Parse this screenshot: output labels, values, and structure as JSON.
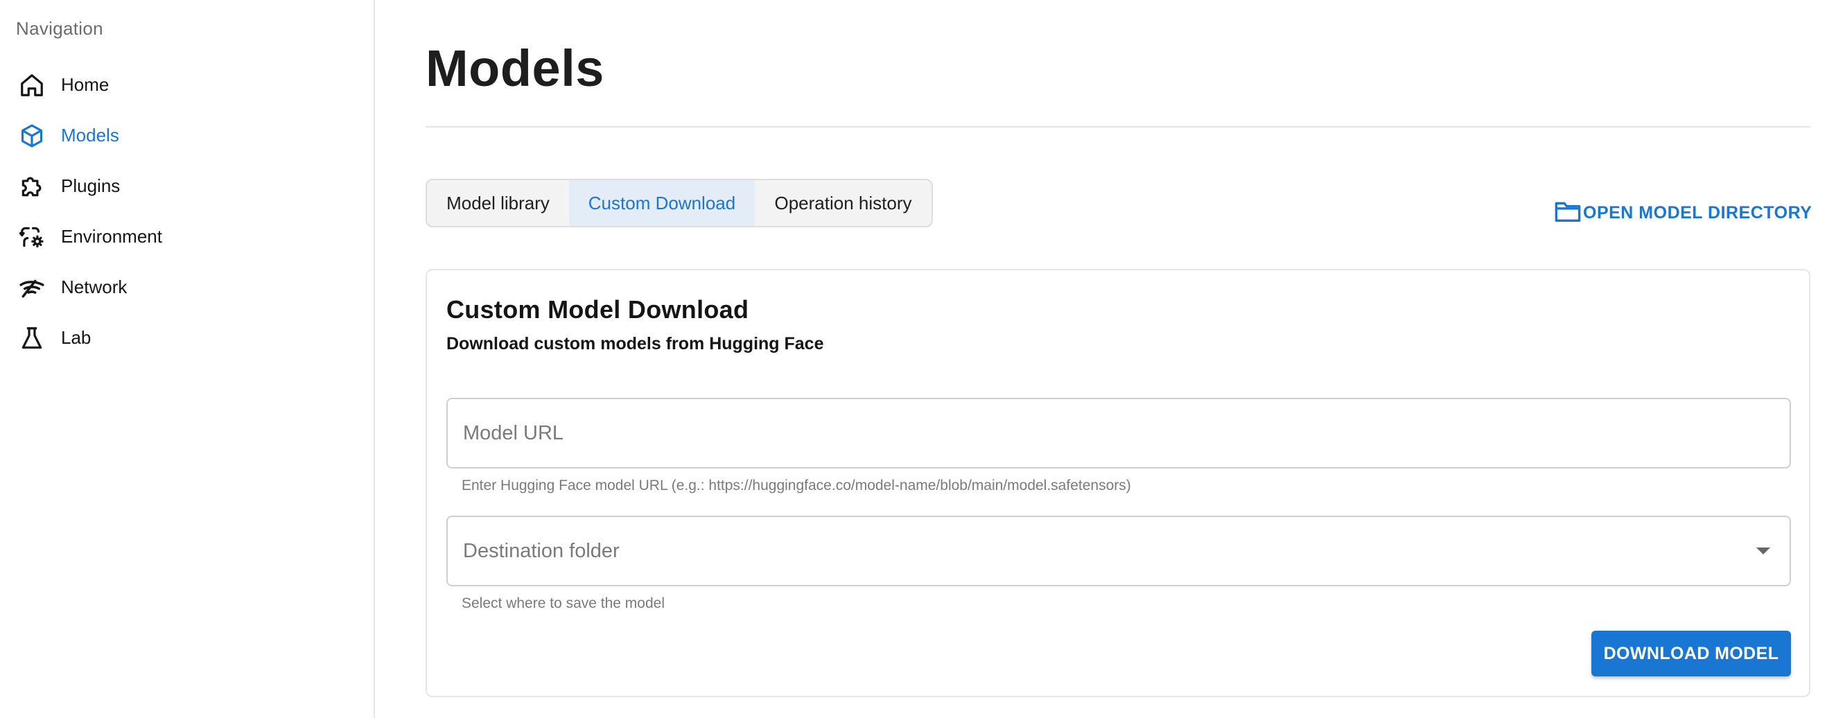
{
  "sidebar": {
    "heading": "Navigation",
    "items": [
      {
        "label": "Home",
        "icon": "home-icon"
      },
      {
        "label": "Models",
        "icon": "cube-icon"
      },
      {
        "label": "Plugins",
        "icon": "puzzle-icon"
      },
      {
        "label": "Environment",
        "icon": "environment-icon"
      },
      {
        "label": "Network",
        "icon": "network-icon"
      },
      {
        "label": "Lab",
        "icon": "flask-icon"
      }
    ],
    "active_item": "Models"
  },
  "main": {
    "title": "Models",
    "tabs": [
      {
        "label": "Model library"
      },
      {
        "label": "Custom Download"
      },
      {
        "label": "Operation history"
      }
    ],
    "active_tab": "Custom Download",
    "open_directory_label": "OPEN MODEL DIRECTORY"
  },
  "card": {
    "title": "Custom Model Download",
    "subtitle": "Download custom models from Hugging Face",
    "url_field": {
      "placeholder": "Model URL",
      "value": "",
      "helper": "Enter Hugging Face model URL (e.g.: https://huggingface.co/model-name/blob/main/model.safetensors)"
    },
    "destination_field": {
      "placeholder": "Destination folder",
      "helper": "Select where to save the model"
    },
    "download_button": "DOWNLOAD MODEL"
  },
  "colors": {
    "accent": "#1976d2",
    "active_tab_bg": "#e3ecf7",
    "text_primary": "#151515",
    "text_muted": "#7a7a7a"
  }
}
